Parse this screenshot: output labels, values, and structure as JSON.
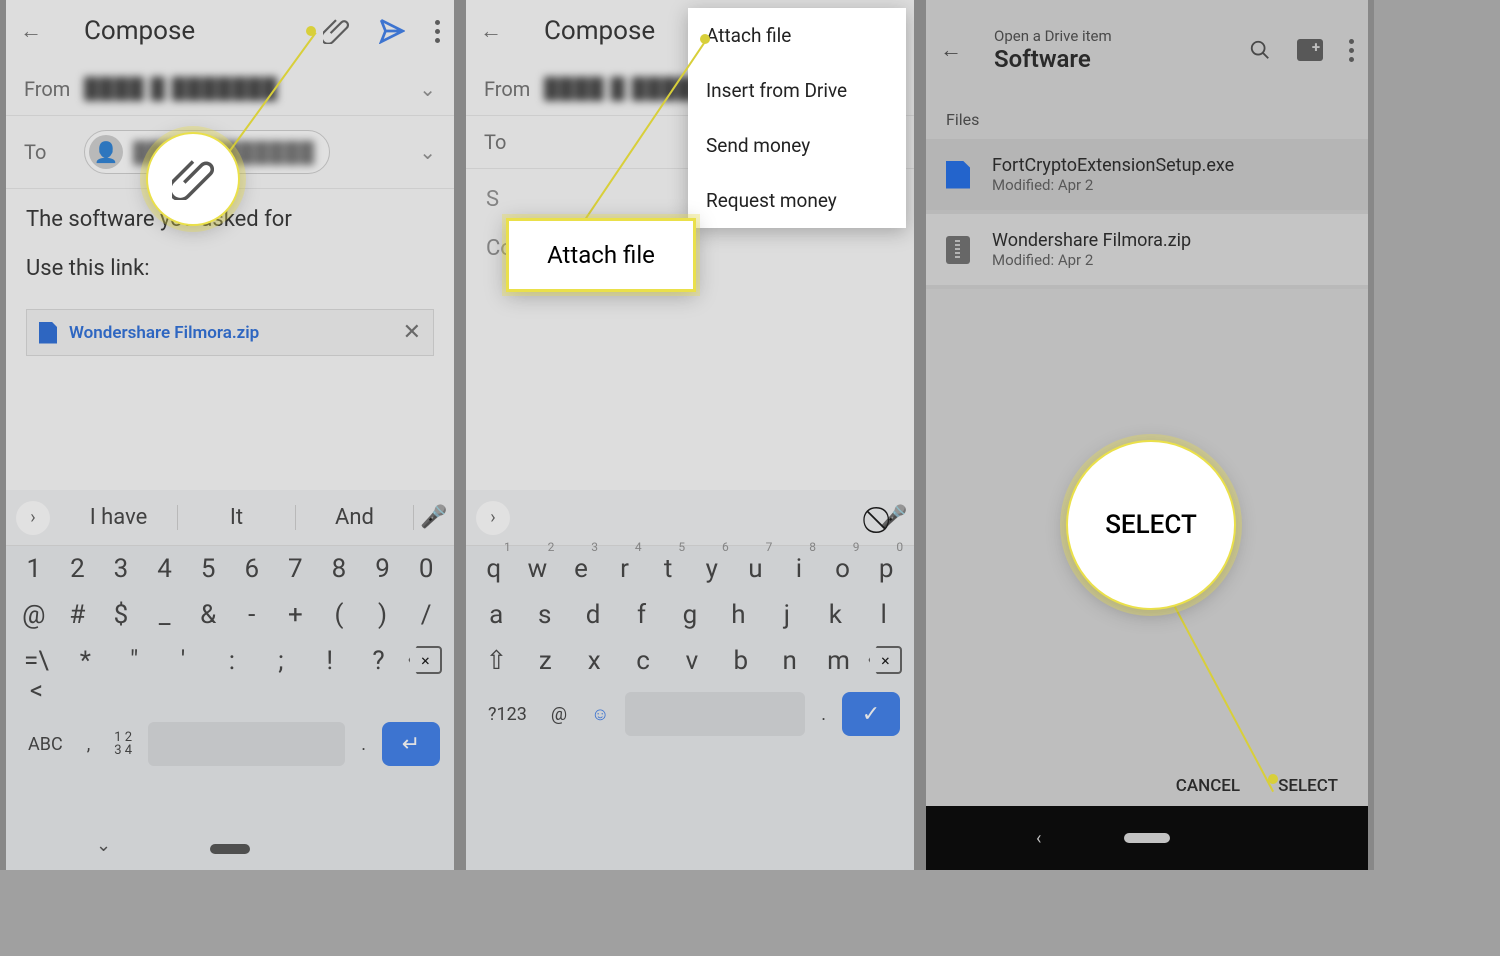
{
  "p1": {
    "title": "Compose",
    "fromLabel": "From",
    "fromValue": "████ █ ███████",
    "toLabel": "To",
    "toValue": "████████████",
    "subject": "The software you asked for",
    "body": "Use this link:",
    "attachment": "Wondershare Filmora.zip",
    "sugg": [
      "I have",
      "It",
      "And"
    ],
    "row1": [
      "1",
      "2",
      "3",
      "4",
      "5",
      "6",
      "7",
      "8",
      "9",
      "0"
    ],
    "row2": [
      "@",
      "#",
      "$",
      "_",
      "&",
      "-",
      "+",
      "(",
      ")",
      "/"
    ],
    "row3": [
      "=\\<",
      "*",
      "\"",
      "'",
      ":",
      ";",
      "!",
      "?"
    ],
    "abc": "ABC",
    "nums": "1 2\n3 4",
    "dot": ".",
    "comma": ","
  },
  "p2": {
    "title": "Compose",
    "fromLabel": "From",
    "fromValue": "████ █ ███████",
    "toLabel": "To",
    "subjectHidden": "S",
    "bodyHidden": "Compose email",
    "menu": [
      "Attach file",
      "Insert from Drive",
      "Send money",
      "Request money"
    ],
    "highlight": "Attach file",
    "q123": "?123",
    "row1": [
      "q",
      "w",
      "e",
      "r",
      "t",
      "y",
      "u",
      "i",
      "o",
      "p"
    ],
    "sup1": [
      "1",
      "2",
      "3",
      "4",
      "5",
      "6",
      "7",
      "8",
      "9",
      "0"
    ],
    "row2": [
      "a",
      "s",
      "d",
      "f",
      "g",
      "h",
      "j",
      "k",
      "l"
    ],
    "row3": [
      "z",
      "x",
      "c",
      "v",
      "b",
      "n",
      "m"
    ],
    "dot": "."
  },
  "p3": {
    "subtitle": "Open a Drive item",
    "title": "Software",
    "section": "Files",
    "files": [
      {
        "name": "FortCryptoExtensionSetup.exe",
        "mod": "Modified: Apr 2",
        "type": "blue"
      },
      {
        "name": "Wondershare Filmora.zip",
        "mod": "Modified: Apr 2",
        "type": "zip"
      }
    ],
    "cancel": "CANCEL",
    "select": "SELECT",
    "highlight": "SELECT"
  }
}
